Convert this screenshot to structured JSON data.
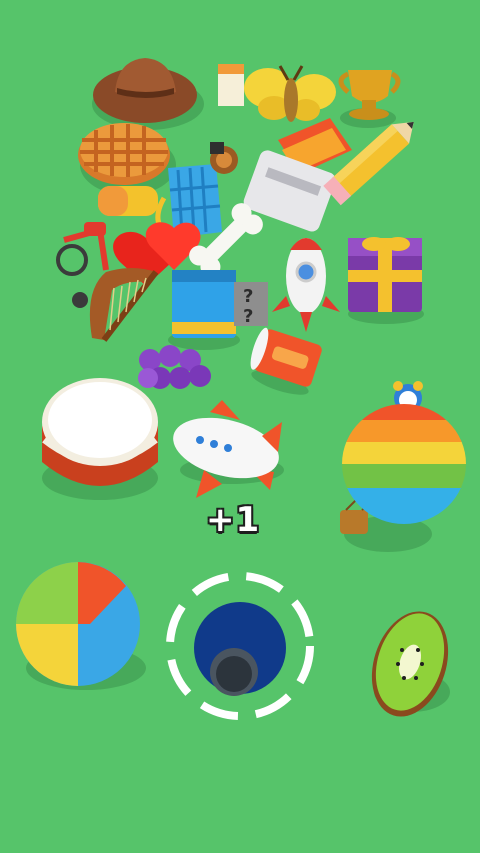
{
  "hud": {
    "score_popup": "+1"
  },
  "colors": {
    "background": "#56c46a",
    "shadow": "#47a95a",
    "hole_ring": "#ffffff",
    "hole_inner": "#103a8a"
  },
  "objects": [
    {
      "name": "cowboy-hat-icon"
    },
    {
      "name": "waffle-icon"
    },
    {
      "name": "shopping-basket-icon"
    },
    {
      "name": "trophy-icon"
    },
    {
      "name": "butterfly-icon"
    },
    {
      "name": "toaster-icon"
    },
    {
      "name": "pencil-icon"
    },
    {
      "name": "tricycle-icon"
    },
    {
      "name": "harp-icon"
    },
    {
      "name": "heart-balloon-icon"
    },
    {
      "name": "bone-icon"
    },
    {
      "name": "book-icon"
    },
    {
      "name": "mystery-box-icon"
    },
    {
      "name": "rocket-icon"
    },
    {
      "name": "gift-box-icon"
    },
    {
      "name": "grapes-icon"
    },
    {
      "name": "soda-can-icon"
    },
    {
      "name": "drum-icon"
    },
    {
      "name": "blimp-airship-icon"
    },
    {
      "name": "hot-air-balloon-icon"
    },
    {
      "name": "alarm-clock-icon"
    },
    {
      "name": "beach-ball-icon"
    },
    {
      "name": "kiwi-fruit-icon"
    },
    {
      "name": "black-hole-icon"
    }
  ]
}
